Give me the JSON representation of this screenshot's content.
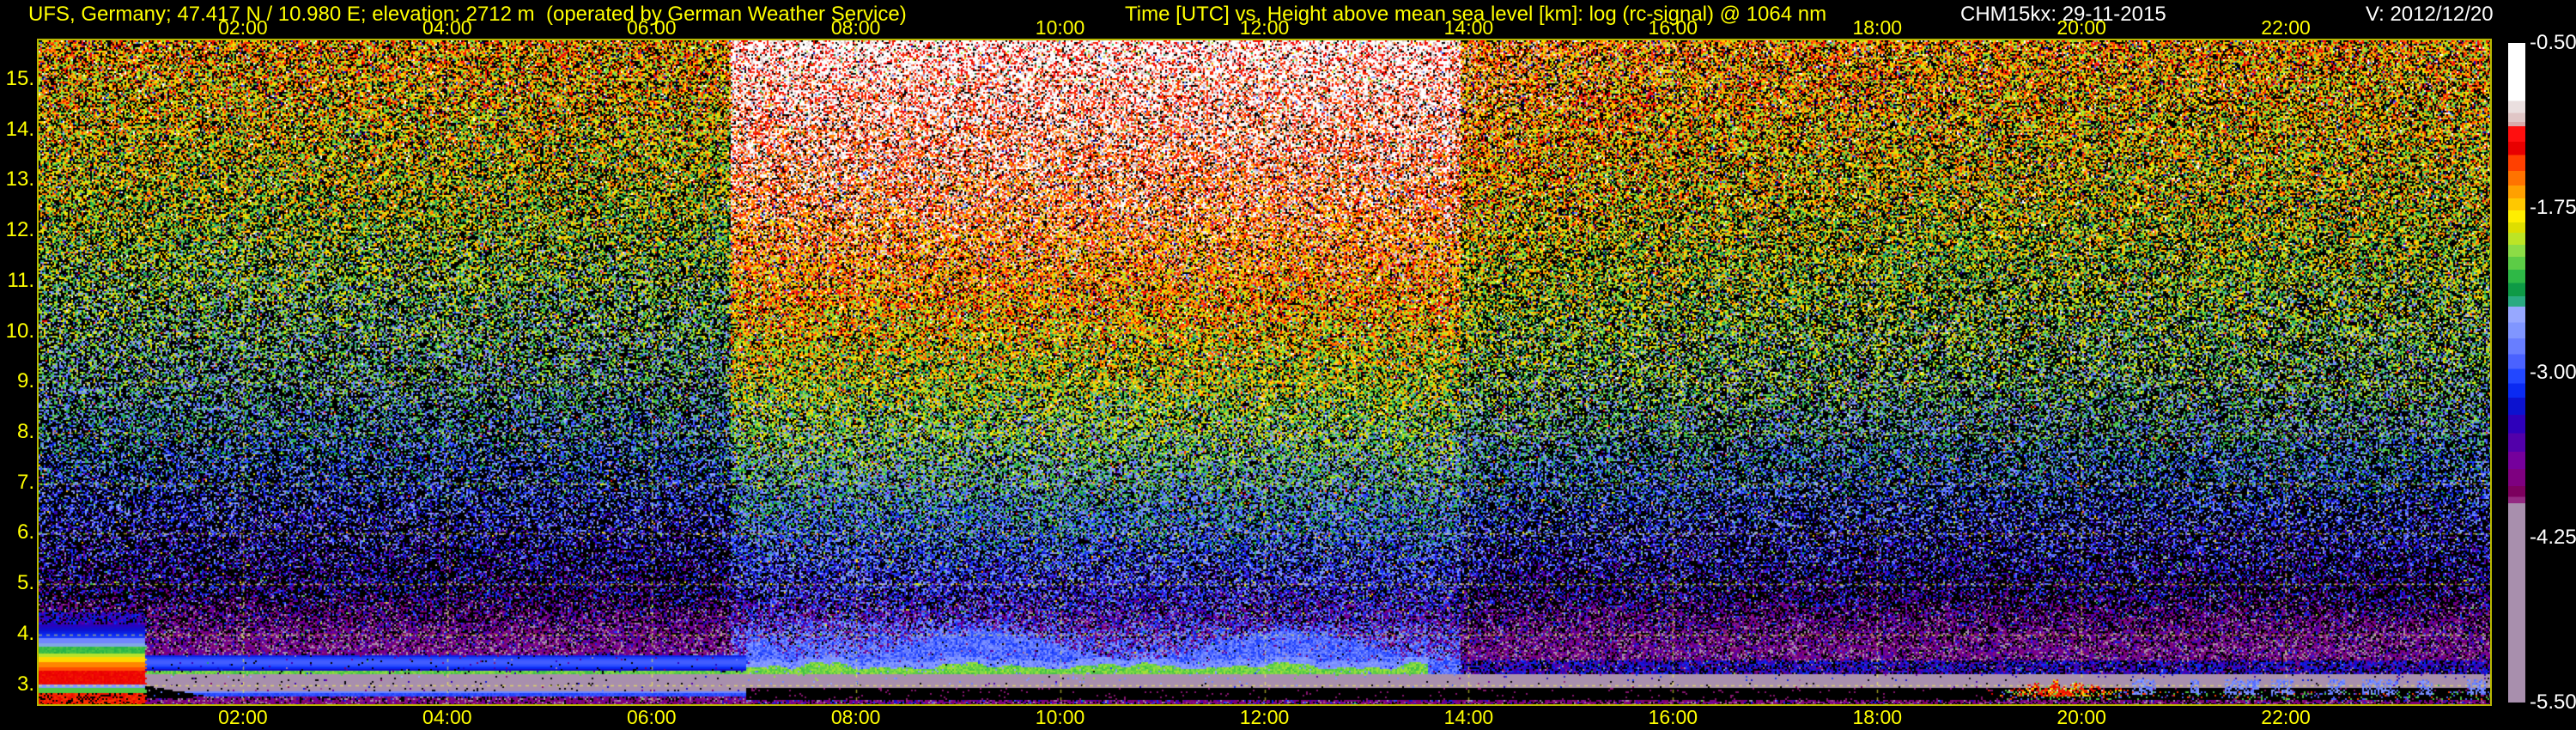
{
  "header": {
    "station": "UFS, Germany; 47.417 N / 10.980 E; elevation: 2712 m  (operated by German Weather Service)",
    "title": "Time [UTC] vs. Height above mean sea level [km]: log (rc-signal) @ 1064 nm",
    "instrument": "CHM15kx: 29-11-2015",
    "version": "V: 2012/12/20"
  },
  "colors": {
    "background": "#000000",
    "axis_text": "#ffff00",
    "header_yellow": "#ffff00",
    "header_white": "#ffffff",
    "colorbar_text": "#ffffff",
    "grid": "rgba(255,255,60,0.6)",
    "frame": "#b8b800"
  },
  "chart_data": {
    "type": "heatmap",
    "title": "log (rc-signal) @ 1064 nm",
    "subtitle": "CHM15kx ceilometer backscatter quicklook, 29-11-2015",
    "x_axis": {
      "label": "Time [UTC]",
      "range_hours": [
        0,
        24
      ],
      "tick_hours": [
        2,
        4,
        6,
        8,
        10,
        12,
        14,
        16,
        18,
        20,
        22
      ],
      "tick_labels": [
        "02:00",
        "04:00",
        "06:00",
        "08:00",
        "10:00",
        "12:00",
        "14:00",
        "16:00",
        "18:00",
        "20:00",
        "22:00"
      ]
    },
    "y_axis": {
      "label": "Height above mean sea level [km]",
      "top_km": 15.78,
      "bottom_km": 2.62,
      "tick_values": [
        15,
        14,
        13,
        12,
        11,
        10,
        9,
        8,
        7,
        6,
        5,
        4,
        3
      ],
      "tick_labels": [
        "15.",
        "14.",
        "13.",
        "12.",
        "11.",
        "10.",
        "9.",
        "8.",
        "7.",
        "6.",
        "5.",
        "4.",
        "3."
      ]
    },
    "colorbar": {
      "label": "log (rc-signal)",
      "range": [
        -0.5,
        -5.5
      ],
      "tick_values": [
        -0.5,
        -1.75,
        -3.0,
        -4.25,
        -5.5
      ],
      "tick_labels": [
        "-0.50",
        "-1.75",
        "-3.00",
        "-4.25",
        "-5.50"
      ],
      "palette_stops": [
        [
          -0.5,
          "#ffffff"
        ],
        [
          -0.86,
          "#ffffff"
        ],
        [
          -0.94,
          "#eadfdf"
        ],
        [
          -1.03,
          "#e0c6c6"
        ],
        [
          -1.1,
          "#d8aaaa"
        ],
        [
          -1.13,
          "#ff0f0f"
        ],
        [
          -1.25,
          "#e80000"
        ],
        [
          -1.35,
          "#ff4000"
        ],
        [
          -1.47,
          "#ff7300"
        ],
        [
          -1.58,
          "#ffa000"
        ],
        [
          -1.68,
          "#ffc800"
        ],
        [
          -1.77,
          "#ffee00"
        ],
        [
          -1.86,
          "#dede00"
        ],
        [
          -1.94,
          "#bce426"
        ],
        [
          -2.03,
          "#8cdc46"
        ],
        [
          -2.12,
          "#5ccc46"
        ],
        [
          -2.22,
          "#2eb846"
        ],
        [
          -2.32,
          "#0e9a46"
        ],
        [
          -2.42,
          "#2aaa82"
        ],
        [
          -2.5,
          "#97a8ff"
        ],
        [
          -2.62,
          "#8096ff"
        ],
        [
          -2.74,
          "#687eff"
        ],
        [
          -2.86,
          "#4a62ff"
        ],
        [
          -2.97,
          "#2247ff"
        ],
        [
          -3.08,
          "#0a2af2"
        ],
        [
          -3.19,
          "#0c12cf"
        ],
        [
          -3.32,
          "#2e00ba"
        ],
        [
          -3.46,
          "#5200aa"
        ],
        [
          -3.6,
          "#75009c"
        ],
        [
          -3.73,
          "#7e0080"
        ],
        [
          -3.86,
          "#7c005e"
        ],
        [
          -3.94,
          "#942a82"
        ],
        [
          -3.99,
          "#a88fad"
        ],
        [
          -5.5,
          "#a88fad"
        ]
      ]
    },
    "scene": {
      "seed": 20151129,
      "sigma": 0.52,
      "outlier_prob": 0.045,
      "mean_profile": [
        [
          15.8,
          -1.62
        ],
        [
          12.5,
          -1.9
        ],
        [
          10.5,
          -2.2
        ],
        [
          9.0,
          -2.4
        ],
        [
          7.5,
          -2.7
        ],
        [
          6.0,
          -3.05
        ],
        [
          5.0,
          -3.3
        ],
        [
          4.2,
          -3.5
        ],
        [
          2.6,
          -3.62
        ]
      ],
      "density": {
        "base": 0.38,
        "slope": 0.34,
        "ref_km": 4.0,
        "span_km": 11.8
      },
      "day": {
        "start": 6.77,
        "end": 13.92,
        "tail_amp": 0.3,
        "tail_decay": 2.2,
        "boost_low": 0.18,
        "boost_high": 0.82,
        "density_boost": 0.22
      },
      "evening": {
        "from": 13.92,
        "amp": 0.12,
        "center_km": 9.5,
        "width_km": 3.2
      },
      "layers": {
        "haze": {
          "h_min": 3.5,
          "h_max": 4.8,
          "density": 0.8,
          "value": -3.75,
          "jitter": 0.7
        },
        "day_dome": {
          "h_min": 3.5,
          "h_max": 4.7,
          "density": 0.55,
          "value": -2.75
        },
        "blue_band_night": {
          "h_min": 3.3,
          "h_max": 3.6,
          "center": 3.45,
          "value": -2.88
        },
        "blue_band_day": {
          "h_min": 3.18,
          "h_max": 4.3,
          "value": -2.82
        },
        "blue_band_evening": {
          "h_min": 3.08,
          "h_max": 3.5,
          "value": -3.25,
          "density": 0.5
        },
        "green_night": {
          "h_min": 3.195,
          "h_max": 3.29,
          "value": -2.1
        },
        "green_day": {
          "center": 3.26,
          "end": 13.6,
          "value": -2.08,
          "halo_value": -2.62
        },
        "green_evening": {
          "from": 19.0,
          "to": 23.9,
          "h_min": 2.76,
          "h_max": 3.0,
          "value": -2.2
        },
        "lavender": {
          "h_min": 2.95,
          "h_max": 3.2,
          "value": -4.6
        },
        "blue_line": {
          "h_min": 2.79,
          "h_max": 2.875,
          "value": -2.95,
          "top_value": -2.7
        },
        "black_band": {
          "from": 6.93,
          "h_min": 2.7,
          "h_max": 2.94,
          "dot_from": 19.2
        },
        "wedge": {
          "from": 1.04,
          "to": 1.62,
          "top_start": 2.99,
          "drop": 0.2,
          "thick_start": 0.22,
          "thick_end": 0.03
        },
        "rainbow_blob": {
          "t_end": 1.05
        },
        "red_blob": {
          "center": 19.8,
          "width": 0.45,
          "h_base": 2.78,
          "h_top": 2.9,
          "spike": 0.22,
          "value": -1.28
        },
        "evening_patches": {
          "from": 20.5,
          "to": 23.95,
          "h_min": 2.82,
          "h_max": 3.1,
          "value": -2.7
        }
      }
    }
  }
}
